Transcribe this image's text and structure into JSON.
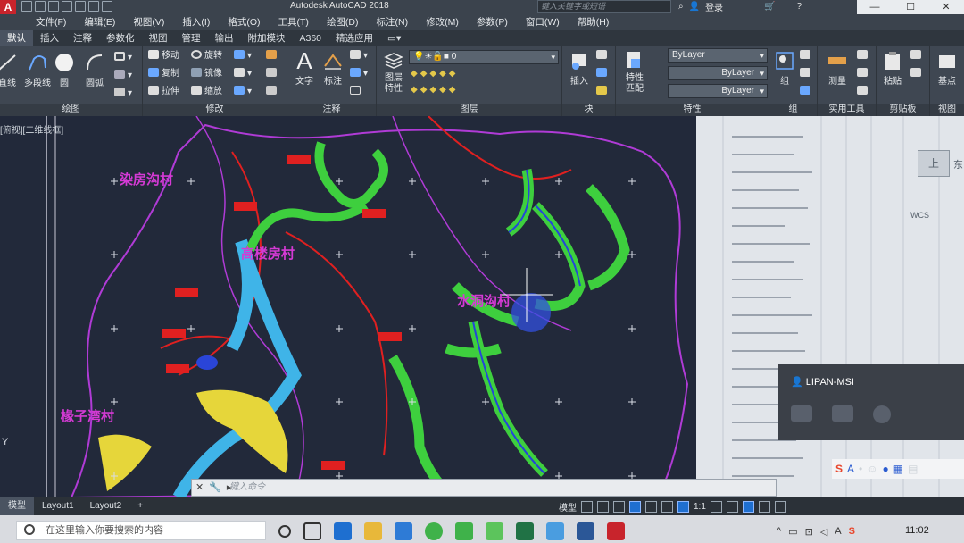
{
  "window": {
    "title": "Autodesk AutoCAD 2018",
    "logo": "A"
  },
  "search": {
    "placeholder": "键入关键字或短语"
  },
  "account": {
    "login": "登录"
  },
  "menu": [
    "文件(F)",
    "编辑(E)",
    "视图(V)",
    "插入(I)",
    "格式(O)",
    "工具(T)",
    "绘图(D)",
    "标注(N)",
    "修改(M)",
    "参数(P)",
    "窗口(W)",
    "帮助(H)"
  ],
  "ribbon_tabs": [
    "默认",
    "插入",
    "注释",
    "参数化",
    "视图",
    "管理",
    "输出",
    "附加模块",
    "A360",
    "精选应用"
  ],
  "panels": {
    "draw": {
      "title": "绘图",
      "tools": [
        "直线",
        "多段线",
        "圆",
        "圆弧"
      ]
    },
    "modify": {
      "title": "修改",
      "tools": [
        "移动",
        "旋转",
        "复制",
        "镜像",
        "拉伸",
        "缩放"
      ]
    },
    "annotation": {
      "title": "注释",
      "tools": [
        "文字",
        "标注"
      ]
    },
    "layers": {
      "title": "图层",
      "layer_props": "图层特性",
      "current_layer": "0"
    },
    "block": {
      "title": "块",
      "insert": "插入"
    },
    "properties": {
      "title": "特性",
      "match": "特性匹配",
      "color": "ByLayer",
      "linetype": "ByLayer",
      "lineweight": "ByLayer"
    },
    "groups": {
      "title": "组",
      "group": "组"
    },
    "utilities": {
      "title": "实用工具",
      "measure": "测量"
    },
    "clipboard": {
      "title": "剪贴板",
      "paste": "粘贴"
    },
    "view": {
      "title": "视图",
      "base": "基点"
    }
  },
  "viewport": {
    "control": "[俯视][二维线框]",
    "labels": [
      "染房沟村",
      "高楼房村",
      "水洞沟村",
      "椽子湾村"
    ]
  },
  "navcube": {
    "face": "上",
    "east": "东",
    "wcs": "WCS"
  },
  "popup": {
    "user": "LIPAN-MSI"
  },
  "command": {
    "placeholder": "键入命令"
  },
  "layout_tabs": [
    "模型",
    "Layout1",
    "Layout2",
    "+"
  ],
  "status": {
    "model": "模型",
    "scale": "1:1"
  },
  "taskbar": {
    "search_placeholder": "在这里输入你要搜索的内容",
    "time": "11:02"
  },
  "colors": {
    "accent": "#1f6fd0",
    "brand": "#c8242c"
  }
}
